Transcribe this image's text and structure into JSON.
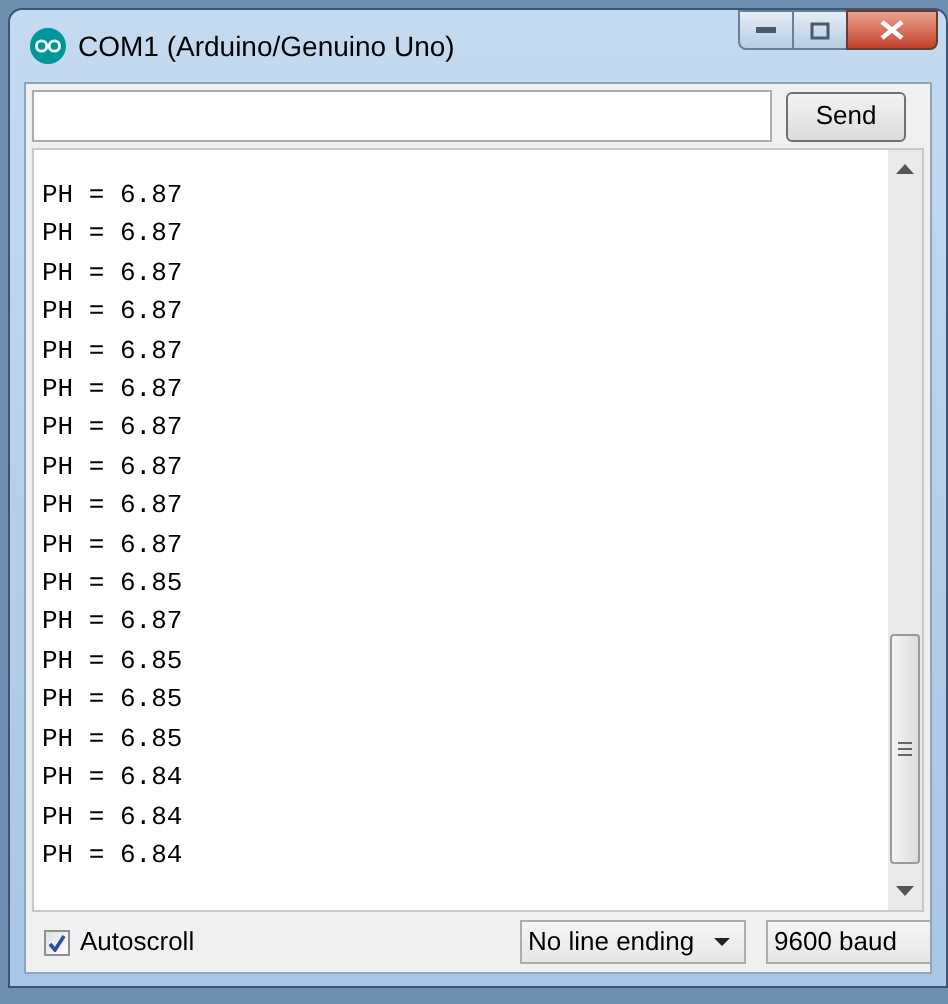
{
  "window": {
    "title": "COM1 (Arduino/Genuino Uno)"
  },
  "send_button": "Send",
  "output_lines": [
    "PH = 6.87",
    "PH = 6.87",
    "PH = 6.87",
    "PH = 6.87",
    "PH = 6.87",
    "PH = 6.87",
    "PH = 6.87",
    "PH = 6.87",
    "PH = 6.87",
    "PH = 6.87",
    "PH = 6.85",
    "PH = 6.87",
    "PH = 6.85",
    "PH = 6.85",
    "PH = 6.85",
    "PH = 6.84",
    "PH = 6.84",
    "PH = 6.84"
  ],
  "autoscroll": {
    "label": "Autoscroll",
    "checked": true
  },
  "line_ending": {
    "value": "No line ending"
  },
  "baud_rate": {
    "value": "9600 baud"
  }
}
